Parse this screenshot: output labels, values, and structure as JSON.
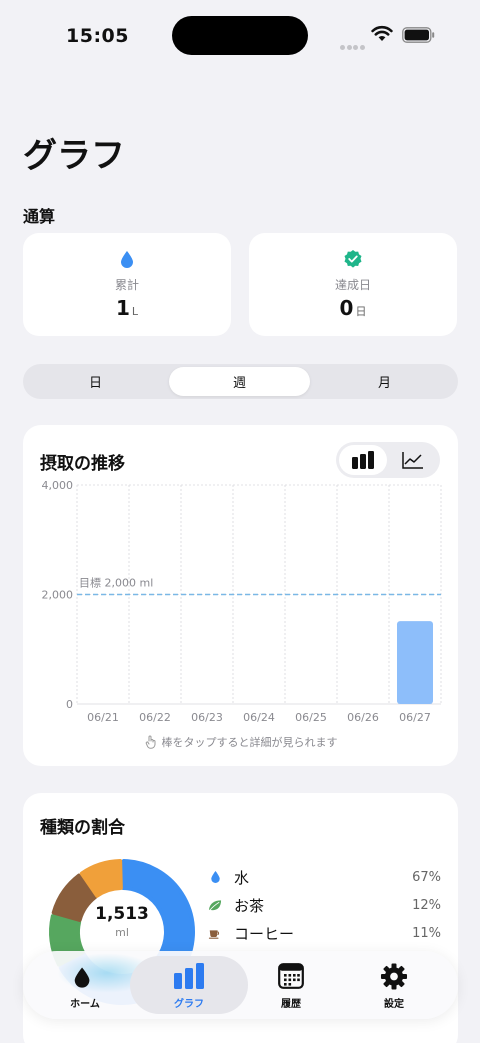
{
  "status_bar": {
    "time": "15:05"
  },
  "page": {
    "title": "グラフ"
  },
  "totals": {
    "section_label": "通算",
    "cumulative": {
      "label": "累計",
      "value": "1",
      "unit": "L",
      "icon": "water-drop-icon"
    },
    "achieved_days": {
      "label": "達成日",
      "value": "0",
      "unit": "日",
      "icon": "check-badge-icon"
    }
  },
  "period_tabs": {
    "items": [
      "日",
      "週",
      "月"
    ],
    "selected": "週"
  },
  "intake_chart": {
    "title": "摂取の推移",
    "toggle": {
      "selected": "bar",
      "options": [
        "bar-chart-icon",
        "line-chart-icon"
      ]
    },
    "hint": "棒をタップすると詳細が見られます"
  },
  "chart_data": {
    "type": "bar",
    "title": "摂取の推移",
    "categories": [
      "06/21",
      "06/22",
      "06/23",
      "06/24",
      "06/25",
      "06/26",
      "06/27"
    ],
    "values": [
      0,
      0,
      0,
      0,
      0,
      0,
      1513
    ],
    "ylim": [
      0,
      4000
    ],
    "yticks": [
      "4,000",
      "2,000",
      "0"
    ],
    "ytick_values": [
      4000,
      2000,
      0
    ],
    "goal": {
      "label": "目標 2,000 ml",
      "value": 2000
    },
    "grid": true,
    "bar_color": "#8dbefa",
    "goal_color": "#7ab8e6"
  },
  "ratio": {
    "title": "種類の割合",
    "total_value": "1,513",
    "total_unit": "ml",
    "segments": [
      {
        "name": "水",
        "percent": "67%",
        "value": 67,
        "color": "#3b8ff3",
        "icon": "water-drop-icon"
      },
      {
        "name": "お茶",
        "percent": "12%",
        "value": 12,
        "color": "#56a75f",
        "icon": "tea-leaf-icon"
      },
      {
        "name": "コーヒー",
        "percent": "11%",
        "value": 11,
        "color": "#8a5e3c",
        "icon": "coffee-cup-icon"
      },
      {
        "name": "",
        "percent": "",
        "value": 10,
        "color": "#f0a03a",
        "icon": ""
      }
    ]
  },
  "tab_bar": {
    "items": [
      {
        "label": "ホーム",
        "icon": "home-drop-icon"
      },
      {
        "label": "グラフ",
        "icon": "bar-chart-icon"
      },
      {
        "label": "履歴",
        "icon": "calendar-icon"
      },
      {
        "label": "設定",
        "icon": "gear-icon"
      }
    ],
    "active": "グラフ",
    "accent": "#2d7bf0"
  }
}
